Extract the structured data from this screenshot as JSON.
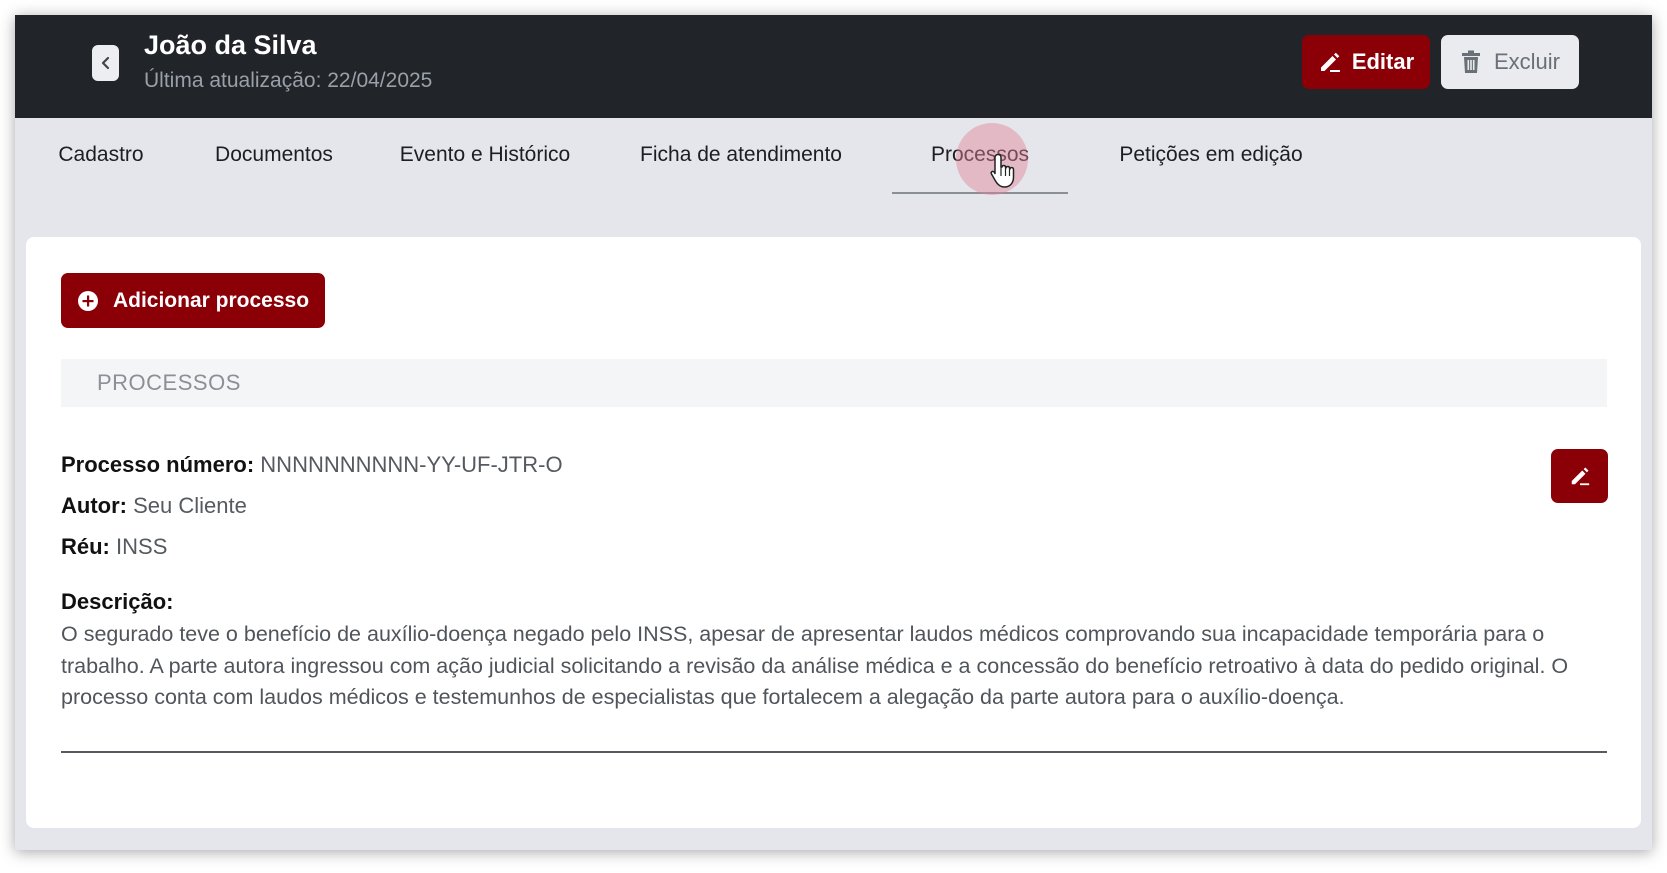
{
  "header": {
    "title": "João da Silva",
    "subtitle": "Última atualização: 22/04/2025",
    "edit_label": "Editar",
    "delete_label": "Excluir"
  },
  "tabs": [
    {
      "label": "Cadastro"
    },
    {
      "label": "Documentos"
    },
    {
      "label": "Evento e Histórico"
    },
    {
      "label": "Ficha de atendimento"
    },
    {
      "label": "Processos",
      "active": true
    },
    {
      "label": "Petições em edição"
    }
  ],
  "main": {
    "add_button_label": "Adicionar processo",
    "section_title": "PROCESSOS",
    "process": {
      "numero_label": "Processo número:",
      "numero_value": "NNNNNNNNNN-YY-UF-JTR-O",
      "autor_label": "Autor:",
      "autor_value": "Seu Cliente",
      "reu_label": "Réu:",
      "reu_value": "INSS",
      "descricao_label": "Descrição:",
      "descricao_value": "O segurado teve o benefício de auxílio-doença negado pelo INSS, apesar de apresentar laudos médicos comprovando sua incapacidade temporária para o trabalho. A parte autora ingressou com ação judicial solicitando a revisão da análise médica e a concessão do benefício retroativo à data do pedido original. O processo conta com laudos médicos e testemunhos de especialistas que fortalecem a alegação da parte autora para o auxílio-doença."
    }
  },
  "colors": {
    "header_bg": "#212429",
    "accent": "#8b0007",
    "page_bg": "#e4e6eb"
  },
  "icons": [
    "chevron-left-icon",
    "pencil-icon",
    "trash-icon",
    "plus-circle-icon",
    "hand-cursor-icon"
  ]
}
